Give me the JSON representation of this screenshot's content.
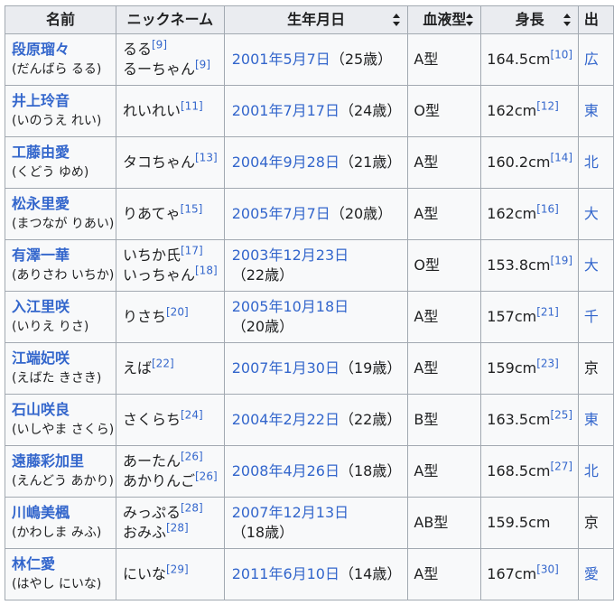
{
  "headers": {
    "name": "名前",
    "nickname": "ニックネーム",
    "birthdate": "生年月日",
    "blood": "血液型",
    "height": "身長",
    "birthplace": "出"
  },
  "rows": [
    {
      "name": "段原瑠々",
      "reading": "(だんばら るる)",
      "nicknames": [
        {
          "text": "るる",
          "ref": "[9]"
        },
        {
          "text": "るーちゃん",
          "ref": "[9]"
        }
      ],
      "birth": "2001年5月7日",
      "age": "（25歳）",
      "blood": "A型",
      "height": "164.5cm",
      "height_ref": "[10]",
      "place": "広"
    },
    {
      "name": "井上玲音",
      "reading": "(いのうえ れい)",
      "nicknames": [
        {
          "text": "れいれい",
          "ref": "[11]"
        }
      ],
      "birth": "2001年7月17日",
      "age": "（24歳）",
      "blood": "O型",
      "height": "162cm",
      "height_ref": "[12]",
      "place": "東"
    },
    {
      "name": "工藤由愛",
      "reading": "(くどう ゆめ)",
      "nicknames": [
        {
          "text": "タコちゃん",
          "ref": "[13]"
        }
      ],
      "birth": "2004年9月28日",
      "age": "（21歳）",
      "blood": "A型",
      "height": "160.2cm",
      "height_ref": "[14]",
      "place": "北"
    },
    {
      "name": "松永里愛",
      "reading": "(まつなが りあい)",
      "nicknames": [
        {
          "text": "りあてゃ",
          "ref": "[15]"
        }
      ],
      "birth": "2005年7月7日",
      "age": "（20歳）",
      "blood": "A型",
      "height": "162cm",
      "height_ref": "[16]",
      "place": "大"
    },
    {
      "name": "有澤一華",
      "reading": "(ありさわ いちか)",
      "nicknames": [
        {
          "text": "いちか氏",
          "ref": "[17]"
        },
        {
          "text": "いっちゃん",
          "ref": "[18]"
        }
      ],
      "birth": "2003年12月23日",
      "age": "（22歳）",
      "blood": "O型",
      "height": "153.8cm",
      "height_ref": "[19]",
      "place": "大"
    },
    {
      "name": "入江里咲",
      "reading": "(いりえ りさ)",
      "nicknames": [
        {
          "text": "りさち",
          "ref": "[20]"
        }
      ],
      "birth": "2005年10月18日",
      "age": "（20歳）",
      "blood": "A型",
      "height": "157cm",
      "height_ref": "[21]",
      "place": "千"
    },
    {
      "name": "江端妃咲",
      "reading": "(えばた きさき)",
      "nicknames": [
        {
          "text": "えば",
          "ref": "[22]"
        }
      ],
      "birth": "2007年1月30日",
      "age": "（19歳）",
      "blood": "A型",
      "height": "159cm",
      "height_ref": "[23]",
      "place": "京"
    },
    {
      "name": "石山咲良",
      "reading": "(いしやま さくら)",
      "nicknames": [
        {
          "text": "さくらち",
          "ref": "[24]"
        }
      ],
      "birth": "2004年2月22日",
      "age": "（22歳）",
      "blood": "B型",
      "height": "163.5cm",
      "height_ref": "[25]",
      "place": "東"
    },
    {
      "name": "遠藤彩加里",
      "reading": "(えんどう あかり)",
      "nicknames": [
        {
          "text": "あーたん",
          "ref": "[26]"
        },
        {
          "text": "あかりんご",
          "ref": "[26]"
        }
      ],
      "birth": "2008年4月26日",
      "age": "（18歳）",
      "blood": "A型",
      "height": "168.5cm",
      "height_ref": "[27]",
      "place": "北"
    },
    {
      "name": "川嶋美楓",
      "reading": "(かわしま みふ)",
      "nicknames": [
        {
          "text": "みっぷる",
          "ref": "[28]"
        },
        {
          "text": "おみふ",
          "ref": "[28]"
        }
      ],
      "birth": "2007年12月13日",
      "age": "（18歳）",
      "blood": "AB型",
      "height": "159.5cm",
      "height_ref": "",
      "place": "京"
    },
    {
      "name": "林仁愛",
      "reading": "(はやし にいな)",
      "nicknames": [
        {
          "text": "にいな",
          "ref": "[29]"
        }
      ],
      "birth": "2011年6月10日",
      "age": "（14歳）",
      "blood": "A型",
      "height": "167cm",
      "height_ref": "[30]",
      "place": "愛"
    }
  ]
}
